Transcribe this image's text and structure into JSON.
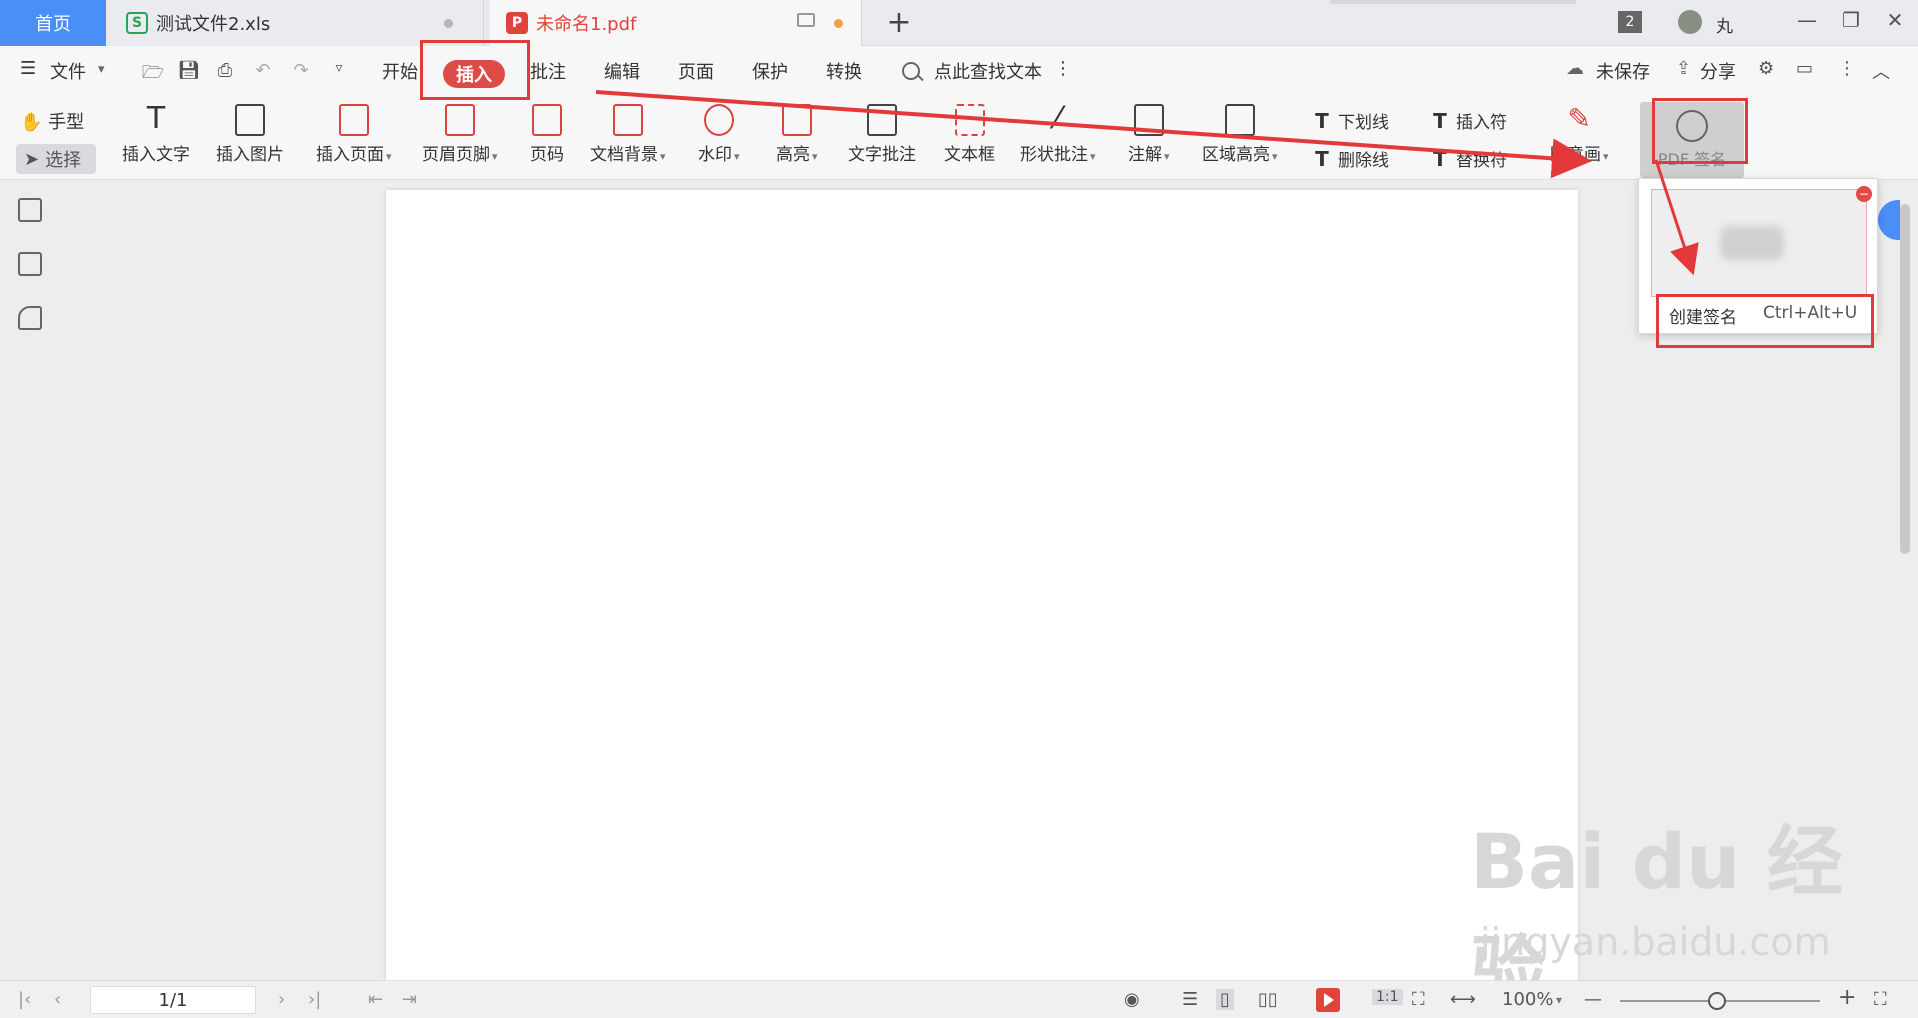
{
  "tabs": {
    "home": "首页",
    "file1": "测试文件2.xls",
    "file2": "未命名1.pdf"
  },
  "header": {
    "window_badge": "2",
    "user_name": "丸"
  },
  "menu": {
    "file": "文件",
    "items": [
      "开始",
      "插入",
      "批注",
      "编辑",
      "页面",
      "保护",
      "转换"
    ],
    "active": "插入",
    "search": "点此查找文本",
    "unsaved": "未保存",
    "share": "分享"
  },
  "ribbon": {
    "hand": "手型",
    "select": "选择",
    "insert_text": "插入文字",
    "insert_image": "插入图片",
    "insert_page": "插入页面",
    "header_footer": "页眉页脚",
    "page_number": "页码",
    "doc_background": "文档背景",
    "watermark": "水印",
    "highlight": "高亮",
    "text_comment": "文字批注",
    "text_box": "文本框",
    "shape_comment": "形状批注",
    "annotation": "注解",
    "area_highlight": "区域高亮",
    "underline": "下划线",
    "strikethrough": "删除线",
    "insert_mark": "插入符",
    "replace_mark": "替换符",
    "freehand": "随意画",
    "pdf_sign": "PDF 签名"
  },
  "dropdown": {
    "create_signature": "创建签名",
    "shortcut": "Ctrl+Alt+U"
  },
  "status": {
    "page": "1/1",
    "zoom": "100%"
  },
  "watermark": {
    "main": "Bai du 经验",
    "sub": "jingyan.baidu.com"
  },
  "colors": {
    "accent_blue": "#4a8ef7",
    "active_red": "#dd4b47",
    "annotation_red": "#e3393a"
  }
}
